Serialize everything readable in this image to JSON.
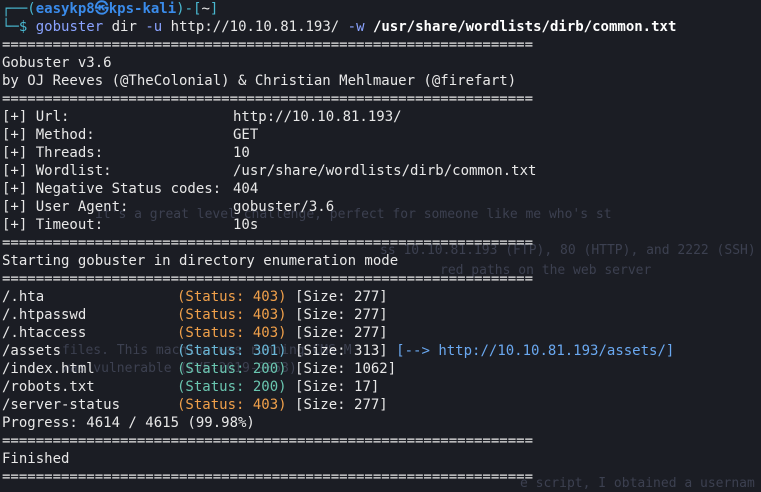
{
  "prompt": {
    "corner_top": "┌──(",
    "user": "easykp8",
    "at": "㉿",
    "host": "kps-kali",
    "close_open": ")-[",
    "cwd": "~",
    "close": "]",
    "corner_bottom": "└─$"
  },
  "command": {
    "name": "gobuster",
    "args1": "dir",
    "flag_u": "-u",
    "url": "http://10.10.81.193/",
    "flag_w": "-w",
    "wordlist": "/usr/share/wordlists/dirb/common.txt"
  },
  "separator": "===============================================================",
  "banner": {
    "version": "Gobuster v3.6",
    "authors": "by OJ Reeves (@TheColonial) & Christian Mehlmauer (@firefart)"
  },
  "config": [
    {
      "label": "[+] Url:",
      "value": "http://10.10.81.193/"
    },
    {
      "label": "[+] Method:",
      "value": "GET"
    },
    {
      "label": "[+] Threads:",
      "value": "10"
    },
    {
      "label": "[+] Wordlist:",
      "value": "/usr/share/wordlists/dirb/common.txt"
    },
    {
      "label": "[+] Negative Status codes:",
      "value": "404"
    },
    {
      "label": "[+] User Agent:",
      "value": "gobuster/3.6"
    },
    {
      "label": "[+] Timeout:",
      "value": "10s"
    }
  ],
  "start_msg": "Starting gobuster in directory enumeration mode",
  "results": [
    {
      "path": "/.hta",
      "status": "(Status: 403)",
      "code": "403",
      "size": "[Size: 277]",
      "redirect": ""
    },
    {
      "path": "/.htpasswd",
      "status": "(Status: 403)",
      "code": "403",
      "size": "[Size: 277]",
      "redirect": ""
    },
    {
      "path": "/.htaccess",
      "status": "(Status: 403)",
      "code": "403",
      "size": "[Size: 277]",
      "redirect": ""
    },
    {
      "path": "/assets",
      "status": "(Status: 301)",
      "code": "301",
      "size": "[Size: 313]",
      "redirect": "[--> http://10.10.81.193/assets/]"
    },
    {
      "path": "/index.html",
      "status": "(Status: 200)",
      "code": "200",
      "size": "[Size: 1062]",
      "redirect": ""
    },
    {
      "path": "/robots.txt",
      "status": "(Status: 200)",
      "code": "200",
      "size": "[Size: 17]",
      "redirect": ""
    },
    {
      "path": "/server-status",
      "status": "(Status: 403)",
      "code": "403",
      "size": "[Size: 277]",
      "redirect": ""
    }
  ],
  "progress": "Progress: 4614 / 4615 (99.98%)",
  "finished": "Finished",
  "ghost_text": [
    "it's a great level challenge, perfect for someone like me who's st",
    "ss 10.10.81.193 (FTP), 80 (HTTP), and 2222 (SSH)",
    "red paths on the web server",
    "files. This machine was running CMS M",
    "was vulnerable (CVE-2019-9053)",
    "e script, I obtained a usernam"
  ]
}
